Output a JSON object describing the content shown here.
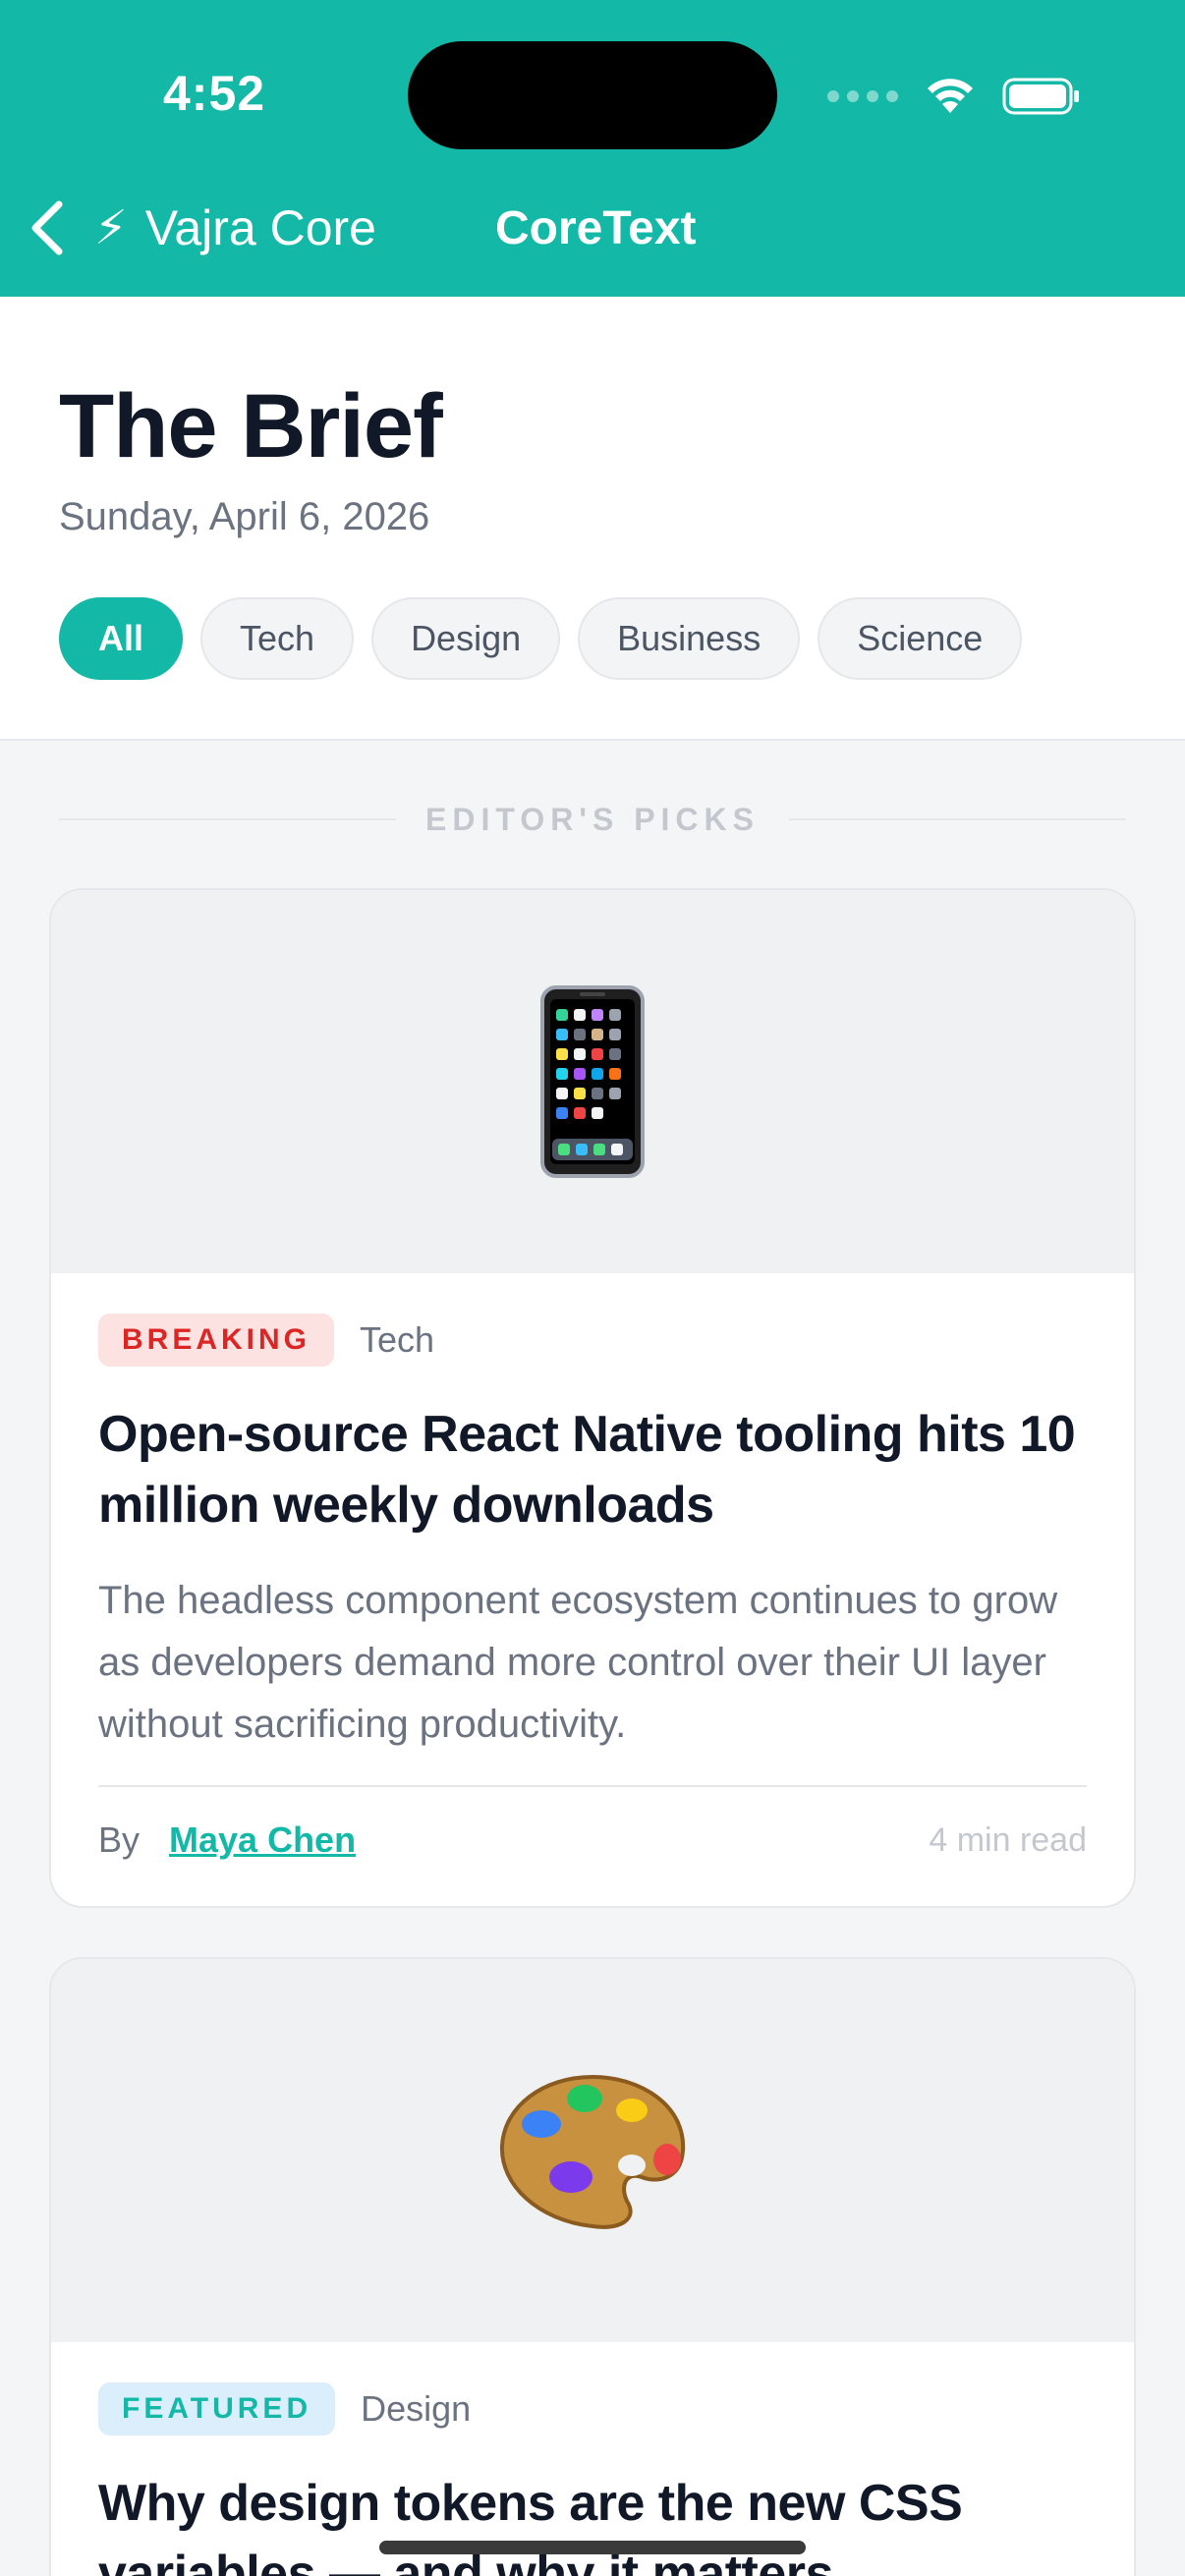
{
  "status_bar": {
    "time": "4:52"
  },
  "nav": {
    "app_icon": "lightning-bolt-icon",
    "app_name": "Vajra Core",
    "app_emoji": "⚡",
    "title": "CoreText"
  },
  "header": {
    "title": "The Brief",
    "date": "Sunday, April 6, 2026",
    "filters": [
      {
        "label": "All",
        "active": true
      },
      {
        "label": "Tech",
        "active": false
      },
      {
        "label": "Design",
        "active": false
      },
      {
        "label": "Business",
        "active": false
      },
      {
        "label": "Science",
        "active": false
      }
    ]
  },
  "section": {
    "label": "EDITOR'S PICKS"
  },
  "articles": [
    {
      "emoji": "📱",
      "icon": "mobile-phone-icon",
      "badge": "BREAKING",
      "category": "Tech",
      "headline": "Open-source React Native tooling hits 10 million weekly downloads",
      "summary": "The headless component ecosystem continues to grow as developers demand more control over their UI layer without sacrificing productivity.",
      "by": "By",
      "author": "Maya Chen",
      "read_time": "4 min read"
    },
    {
      "emoji": "🎨",
      "icon": "artist-palette-icon",
      "badge": "FEATURED",
      "category": "Design",
      "headline": "Why design tokens are the new CSS variables — and why it matters"
    }
  ],
  "colors": {
    "accent": "#14b8a6",
    "breaking_bg": "#fde2e2",
    "breaking_text": "#dc2626",
    "featured_bg": "#dbeefc"
  }
}
